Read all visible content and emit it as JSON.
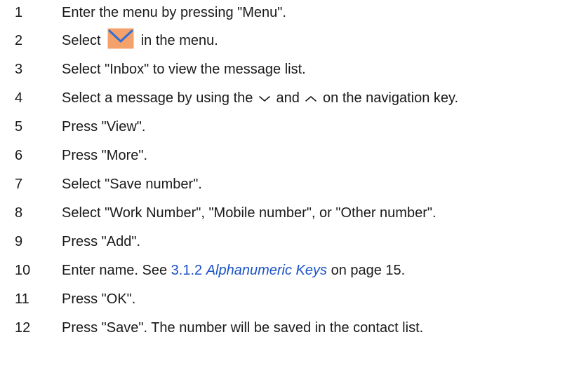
{
  "steps": [
    {
      "num": "1",
      "text": "Enter the menu by pressing \"Menu\"."
    },
    {
      "num": "2",
      "before": "Select",
      "after": "in the menu.",
      "icon": "envelope-icon"
    },
    {
      "num": "3",
      "text": "Select \"Inbox\" to view the message list."
    },
    {
      "num": "4",
      "part1": "Select a message by using the",
      "icon1": "chevron-down-icon",
      "part2": "and",
      "icon2": "chevron-up-icon",
      "part3": "on the navigation key."
    },
    {
      "num": "5",
      "text": "Press \"View\"."
    },
    {
      "num": "6",
      "text": "Press \"More\"."
    },
    {
      "num": "7",
      "text": "Select \"Save number\"."
    },
    {
      "num": "8",
      "text": "Select \"Work Number\", \"Mobile number\", or \"Other number\"."
    },
    {
      "num": "9",
      "text": "Press \"Add\"."
    },
    {
      "num": "10",
      "before": "Enter name. See",
      "link_num": "3.1.2",
      "link_title": "Alphanumeric Keys",
      "after": "on page 15."
    },
    {
      "num": "11",
      "text": "Press \"OK\"."
    },
    {
      "num": "12",
      "text": "Press \"Save\". The number will be saved in the contact list."
    }
  ],
  "colors": {
    "text": "#1a1a1a",
    "link": "#1a52c9",
    "envelope_fill": "#f4a16b",
    "envelope_stroke": "#2e6fd8"
  }
}
